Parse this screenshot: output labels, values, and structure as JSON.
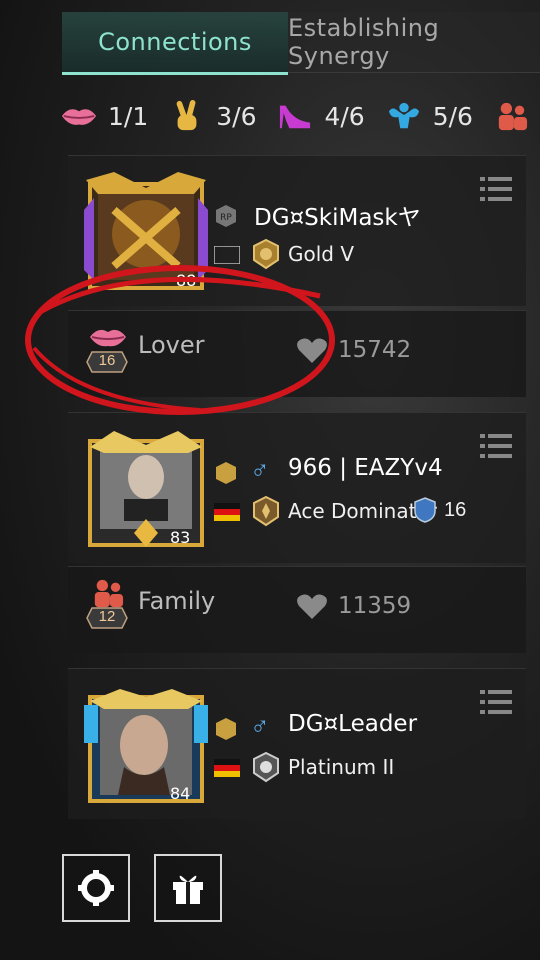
{
  "tabs": [
    {
      "label": "Connections",
      "active": true
    },
    {
      "label": "Establishing Synergy",
      "active": false
    }
  ],
  "stats": [
    {
      "icon": "lips-icon",
      "value": "1/1"
    },
    {
      "icon": "peace-hand-icon",
      "value": "3/6"
    },
    {
      "icon": "high-heel-icon",
      "value": "4/6"
    },
    {
      "icon": "muscle-icon",
      "value": "5/6"
    }
  ],
  "players": [
    {
      "rp_badge": "RP",
      "name": "DG¤SkiMask",
      "suffix": "ヤ",
      "rank": "Gold V",
      "level": "",
      "tier_badge": ""
    },
    {
      "rp_badge": "",
      "gender": "♂",
      "name": "966 | EAZYv4",
      "rank": "Ace Dominator",
      "level": "83",
      "tier_badge": "16"
    },
    {
      "rp_badge": "",
      "gender": "♂",
      "name": "DG¤Leader",
      "rank": "Platinum II",
      "level": "84",
      "tier_badge": ""
    }
  ],
  "relationships": [
    {
      "type": "Lover",
      "icon": "lips-icon",
      "level": "16",
      "intimacy": "15742"
    },
    {
      "type": "Family",
      "icon": "family-icon",
      "level": "12",
      "intimacy": "11359"
    }
  ],
  "colors": {
    "accent": "#8ee3cf",
    "annotation": "#d0161c",
    "gold": "#d8a83a"
  }
}
